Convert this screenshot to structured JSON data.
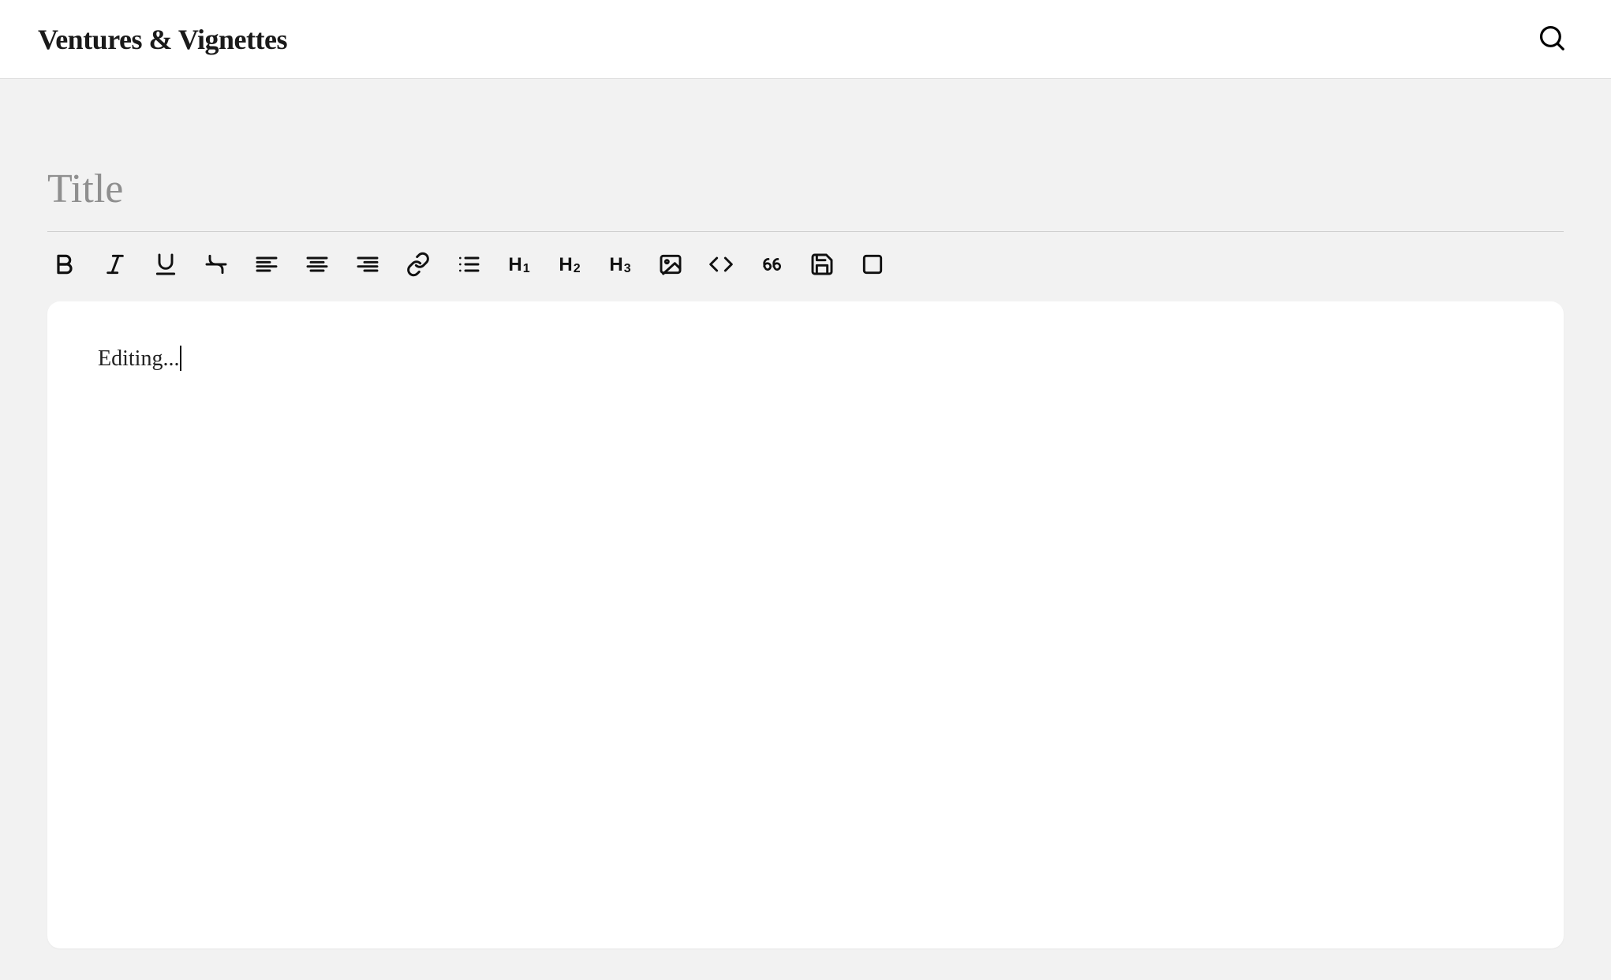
{
  "header": {
    "site_title": "Ventures & Vignettes"
  },
  "editor": {
    "title_placeholder": "Title",
    "title_value": "",
    "body_text": "Editing..."
  },
  "toolbar": {
    "bold": "Bold",
    "italic": "Italic",
    "underline": "Underline",
    "strikethrough": "Strikethrough",
    "align_left": "Align left",
    "align_center": "Align center",
    "align_right": "Align right",
    "link": "Insert link",
    "list": "Bulleted list",
    "h1": "H",
    "h1_sub": "1",
    "h2": "H",
    "h2_sub": "2",
    "h3": "H",
    "h3_sub": "3",
    "image": "Insert image",
    "code": "Code",
    "quote": "Blockquote",
    "save": "Save",
    "card": "Card"
  },
  "icons": {
    "search": "search-icon"
  },
  "colors": {
    "bg": "#f2f2f2",
    "panel": "#ffffff",
    "text": "#1a1a1a",
    "muted": "#8f8f8f",
    "divider": "#cfcfcf"
  }
}
